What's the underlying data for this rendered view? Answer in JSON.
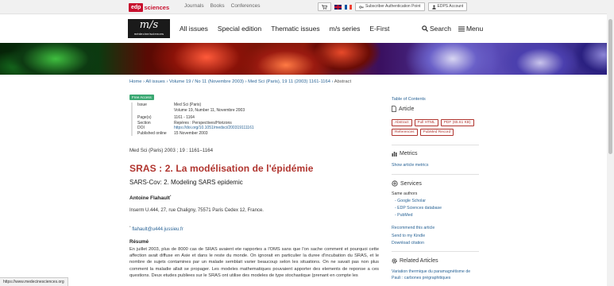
{
  "topbar": {
    "logo_mark": "edp",
    "logo_text": "sciences",
    "links": [
      "Journals",
      "Books",
      "Conferences"
    ],
    "subscriber_label": "Subscriber Authentication Point",
    "account_label": "EDPS Account"
  },
  "header": {
    "logo_main": "m/s",
    "logo_sub": "médecine/sciences",
    "nav": [
      "All issues",
      "Special edition",
      "Thematic issues",
      "m/s series",
      "E-First"
    ],
    "search_label": "Search",
    "menu_label": "Menu"
  },
  "breadcrumb": {
    "items": [
      "Home",
      "All issues",
      "Volume 19 / No 11 (Novembre 2003)",
      "Med Sci (Paris), 19 11 (2003) 1161-1164"
    ],
    "current": "Abstract",
    "separator": "›"
  },
  "article": {
    "access_badge": "Free Access",
    "meta": [
      {
        "key": "Issue",
        "value": "Med Sci (Paris)"
      },
      {
        "key": "",
        "value": "Volume 19, Number 11, Novembre 2003"
      },
      {
        "key": "Page(s)",
        "value": "1161 - 1164"
      },
      {
        "key": "Section",
        "value": "Repères : Perspectives/Horizons"
      },
      {
        "key": "DOI",
        "value": "https://doi.org/10.1051/medsci/200319111161"
      },
      {
        "key": "Published online",
        "value": "15 November 2003"
      }
    ],
    "citation": "Med Sci (Paris) 2003 ; 19 : 1161–1164",
    "title": "SRAS : 2. La modélisation de l'épidémie",
    "subtitle": "SARS-Cov: 2. Modeling SARS epidemic",
    "author": "Antoine Flahault",
    "author_mark": "*",
    "affiliation": "Inserm U.444, 27, rue Chaligny, 75571 Paris Cedex 12, France.",
    "email": "flahault@u444.jussieu.fr",
    "email_mark": "*",
    "abstract_heading": "Résumé",
    "abstract": "En juillet 2003, plus de 8000 cas de SRAS avaient ete rapportes a l'OMS sans que l'on sache comment et pourquoi cette affection avait diffuse en Asie et dans le reste du monde. On ignorait en particulier la duree d'incubation du SRAS, et le nombre de sujets contamines par un malade semblait varier beaucoup selon les situations. On ne savait pas non plus comment la maladie allait se propager. Les modeles mathematiques pouvaient apporter des elements de reponse a ces questions. Deux etudes publiees sur le SRAS ont utilise des modeles de type stochastique (prenant en compte les"
  },
  "sidebar": {
    "toc": "Table of Contents",
    "article_heading": "Article",
    "article_buttons": [
      "Abstract",
      "Full HTML",
      "PDF (65.61 KB)",
      "References",
      "PubMed Record"
    ],
    "metrics_heading": "Metrics",
    "metrics_link": "Show article metrics",
    "services_heading": "Services",
    "same_authors": "Same authors",
    "author_links": [
      "- Google Scholar",
      "- EDP Sciences database",
      "- PubMed"
    ],
    "service_links": [
      "Recommend this article",
      "Send to my Kindle",
      "Download citation"
    ],
    "related_heading": "Related Articles",
    "related_link": "Variation thermique du paramagnétisme de Pauli : carbones prégraphitiques"
  },
  "status_url": "https://www.medecinesciences.org",
  "colors": {
    "title_red": "#b0342e",
    "link_blue": "#2a6496",
    "badge_green": "#3aa872",
    "brand_red": "#c8102e"
  }
}
